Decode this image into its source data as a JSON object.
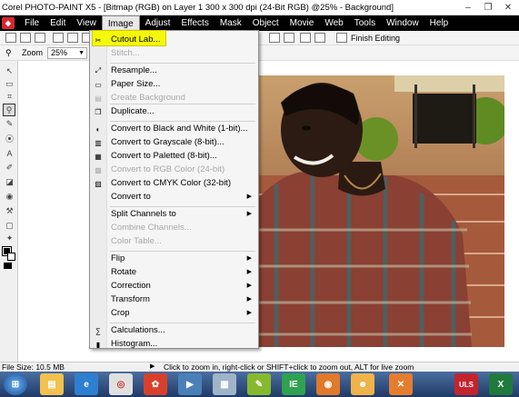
{
  "window": {
    "title": "Corel PHOTO-PAINT X5 - [Bitmap (RGB) on Layer 1 300 x 300 dpi  (24-Bit RGB) @25% - Background]",
    "minimize": "–",
    "maximize": "❐",
    "close": "✕"
  },
  "menubar": {
    "items": [
      "File",
      "Edit",
      "View",
      "Image",
      "Adjust",
      "Effects",
      "Mask",
      "Object",
      "Movie",
      "Web",
      "Tools",
      "Window",
      "Help"
    ],
    "active": "Image"
  },
  "toolbar": {
    "finish_label": "Finish Editing"
  },
  "propbar": {
    "zoom_label": "Zoom",
    "zoom_value": "25%"
  },
  "image_menu": {
    "items": [
      {
        "label": "Cutout Lab...",
        "icon": "scissors-icon",
        "enabled": true,
        "submenu": false,
        "highlighted": true
      },
      {
        "label": "Stitch...",
        "icon": "",
        "enabled": false,
        "submenu": false
      },
      {
        "label": "Resample...",
        "icon": "resample-icon",
        "enabled": true,
        "submenu": false
      },
      {
        "label": "Paper Size...",
        "icon": "paper-size-icon",
        "enabled": true,
        "submenu": false
      },
      {
        "label": "Create Background",
        "icon": "create-background-icon",
        "enabled": false,
        "submenu": false
      },
      {
        "label": "Duplicate...",
        "icon": "duplicate-icon",
        "enabled": true,
        "submenu": false
      },
      {
        "label": "Convert to Black and White (1-bit)...",
        "icon": "bw-icon",
        "enabled": true,
        "submenu": false
      },
      {
        "label": "Convert to Grayscale (8-bit)...",
        "icon": "grayscale-icon",
        "enabled": true,
        "submenu": false
      },
      {
        "label": "Convert to Paletted (8-bit)...",
        "icon": "paletted-icon",
        "enabled": true,
        "submenu": false
      },
      {
        "label": "Convert to RGB Color (24-bit)",
        "icon": "rgb-icon",
        "enabled": false,
        "submenu": false
      },
      {
        "label": "Convert to CMYK Color (32-bit)",
        "icon": "cmyk-icon",
        "enabled": true,
        "submenu": false
      },
      {
        "label": "Convert to",
        "icon": "",
        "enabled": true,
        "submenu": true
      },
      {
        "label": "Split Channels to",
        "icon": "",
        "enabled": true,
        "submenu": true
      },
      {
        "label": "Combine Channels...",
        "icon": "",
        "enabled": false,
        "submenu": false
      },
      {
        "label": "Color Table...",
        "icon": "",
        "enabled": false,
        "submenu": false
      },
      {
        "label": "Flip",
        "icon": "",
        "enabled": true,
        "submenu": true
      },
      {
        "label": "Rotate",
        "icon": "",
        "enabled": true,
        "submenu": true
      },
      {
        "label": "Correction",
        "icon": "",
        "enabled": true,
        "submenu": true
      },
      {
        "label": "Transform",
        "icon": "",
        "enabled": true,
        "submenu": true
      },
      {
        "label": "Crop",
        "icon": "",
        "enabled": true,
        "submenu": true
      },
      {
        "label": "Calculations...",
        "icon": "calculations-icon",
        "enabled": true,
        "submenu": false
      },
      {
        "label": "Histogram...",
        "icon": "histogram-icon",
        "enabled": true,
        "submenu": false
      }
    ]
  },
  "statusbar": {
    "file_size": "File Size: 10.5 MB",
    "hint": "Click to zoom in, right-click or SHIFT+click to zoom out, ALT for live zoom"
  },
  "taskbar": {
    "apps": [
      "start-orb",
      "file-explorer",
      "internet-explorer",
      "chrome",
      "corel-photo-paint",
      "media-player",
      "corel-capture",
      "notepad-plus",
      "firefox",
      "user-app",
      "xampp",
      "uls-app",
      "excel"
    ]
  },
  "colors": {
    "menubar_bg": "#000000",
    "highlight": "#f4f80a",
    "taskbar": "#2c4a7c"
  }
}
